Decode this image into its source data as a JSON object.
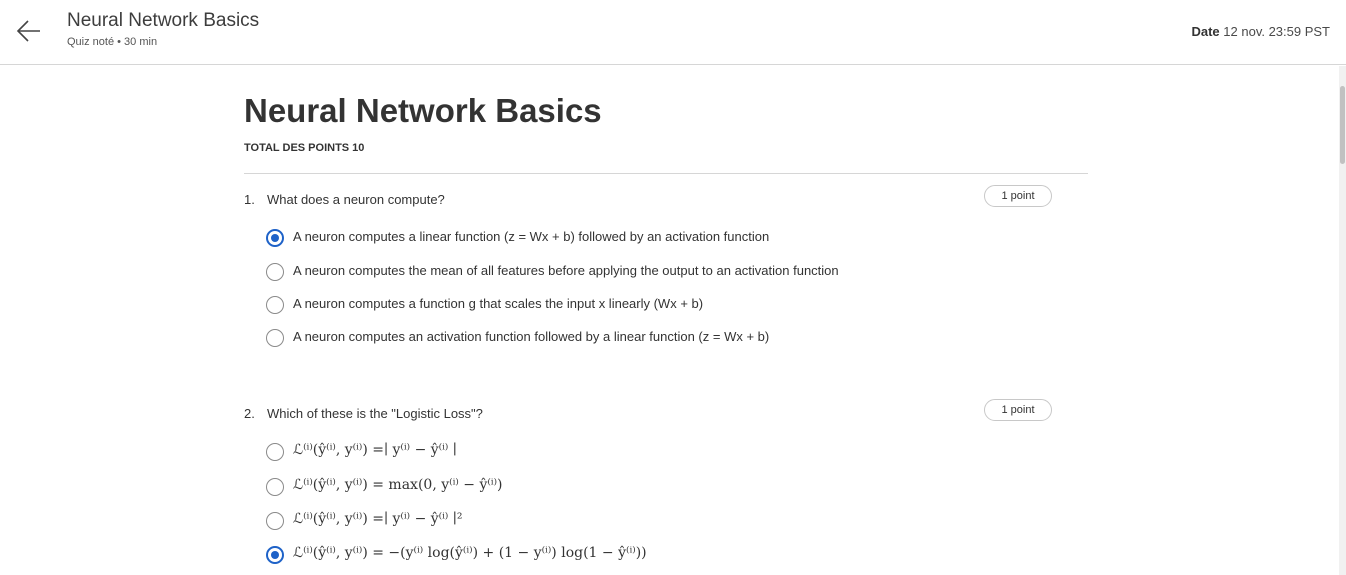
{
  "header": {
    "back_icon": "arrow-left-icon",
    "title": "Neural Network Basics",
    "subtitle": "Quiz noté • 30 min",
    "due_label": "Date",
    "due_value": "12 nov. 23:59 PST"
  },
  "main": {
    "title": "Neural Network Basics",
    "total_points": "TOTAL DES POINTS 10"
  },
  "questions": [
    {
      "number": "1.",
      "text": "What does a neuron compute?",
      "points": "1 point",
      "options": [
        {
          "label": "A neuron computes a linear function (z = Wx + b) followed by an activation function",
          "selected": true
        },
        {
          "label": "A neuron computes the mean of all features before applying the output to an activation function",
          "selected": false
        },
        {
          "label": "A neuron computes a function g that scales the input x linearly (Wx + b)",
          "selected": false
        },
        {
          "label": "A neuron computes an activation function followed by a linear function (z = Wx + b)",
          "selected": false
        }
      ]
    },
    {
      "number": "2.",
      "text": "Which of these is the \"Logistic Loss\"?",
      "points": "1 point",
      "options": [
        {
          "label": "ℒ⁽ⁱ⁾(ŷ⁽ⁱ⁾, y⁽ⁱ⁾) =∣ y⁽ⁱ⁾ − ŷ⁽ⁱ⁾ ∣",
          "selected": false
        },
        {
          "label": "ℒ⁽ⁱ⁾(ŷ⁽ⁱ⁾, y⁽ⁱ⁾) = max(0, y⁽ⁱ⁾ − ŷ⁽ⁱ⁾)",
          "selected": false
        },
        {
          "label": "ℒ⁽ⁱ⁾(ŷ⁽ⁱ⁾, y⁽ⁱ⁾) =∣ y⁽ⁱ⁾ − ŷ⁽ⁱ⁾ ∣²",
          "selected": false
        },
        {
          "label": "ℒ⁽ⁱ⁾(ŷ⁽ⁱ⁾, y⁽ⁱ⁾) = −(y⁽ⁱ⁾ log(ŷ⁽ⁱ⁾) + (1 − y⁽ⁱ⁾) log(1 − ŷ⁽ⁱ⁾))",
          "selected": true
        }
      ]
    }
  ],
  "colors": {
    "accent": "#1e62c8",
    "divider": "#d6d6d6",
    "text": "#333333"
  }
}
